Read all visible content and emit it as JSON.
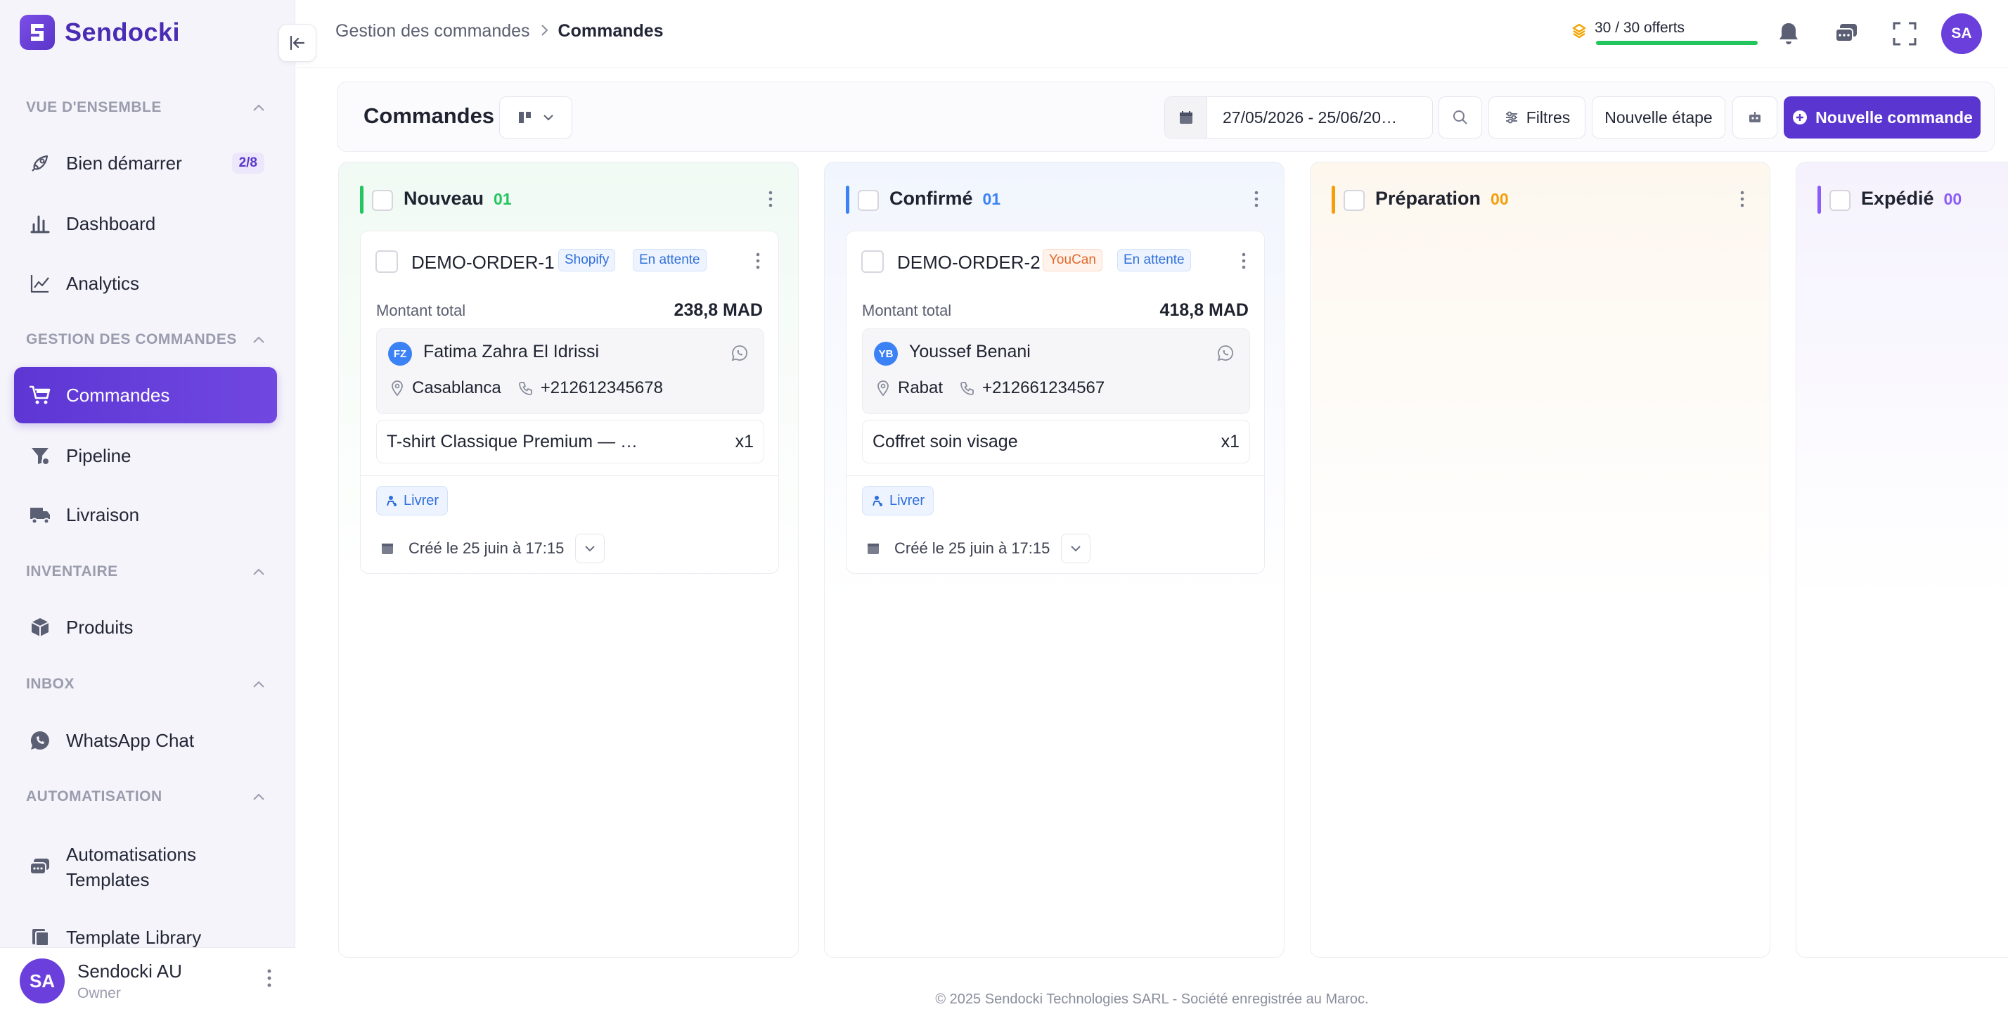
{
  "app": {
    "name": "Sendocki"
  },
  "sidebar": {
    "sections": [
      {
        "label": "VUE D'ENSEMBLE"
      },
      {
        "label": "GESTION DES COMMANDES"
      },
      {
        "label": "INVENTAIRE"
      },
      {
        "label": "INBOX"
      },
      {
        "label": "AUTOMATISATION"
      }
    ],
    "items": [
      {
        "label": "Bien démarrer",
        "count": "2/8",
        "icon": "rocket-icon"
      },
      {
        "label": "Dashboard",
        "icon": "bar-chart-icon"
      },
      {
        "label": "Analytics",
        "icon": "line-chart-icon"
      },
      {
        "label": "Commandes",
        "icon": "cart-icon",
        "active": true
      },
      {
        "label": "Pipeline",
        "icon": "funnel-icon"
      },
      {
        "label": "Livraison",
        "icon": "truck-icon"
      },
      {
        "label": "Produits",
        "icon": "box-icon"
      },
      {
        "label": "WhatsApp Chat",
        "icon": "whatsapp-icon"
      },
      {
        "label_line1": "Automatisations",
        "label_line2": "Templates",
        "icon": "chat-bubbles-icon"
      },
      {
        "label": "Template Library",
        "icon": "library-icon"
      }
    ],
    "user": {
      "initials": "SA",
      "name": "Sendocki AU",
      "role": "Owner"
    }
  },
  "header": {
    "breadcrumb": [
      "Gestion des commandes",
      "Commandes"
    ],
    "credits": {
      "text": "30 / 30 offerts",
      "progress": 1.0
    },
    "avatar": "SA"
  },
  "toolbar": {
    "title": "Commandes",
    "date_range": "27/05/2026 - 25/06/20…",
    "filters_label": "Filtres",
    "new_stage_label": "Nouvelle étape",
    "new_order_label": "Nouvelle commande"
  },
  "columns": [
    {
      "title": "Nouveau",
      "count": "01",
      "color": "#22c55e",
      "tint": "#f1faf4"
    },
    {
      "title": "Confirmé",
      "count": "01",
      "color": "#3b82f6",
      "tint": "#f1f5fd"
    },
    {
      "title": "Préparation",
      "count": "00",
      "color": "#f59e0b",
      "tint": "#fdf7ee"
    },
    {
      "title": "Expédié",
      "count": "00",
      "color": "#8b5cf6",
      "tint": "#f5f2fd"
    }
  ],
  "cards": [
    {
      "order_id": "DEMO-ORDER-1",
      "source": "Shopify",
      "status": "En attente",
      "total_label": "Montant total",
      "total": "238,8 MAD",
      "customer_initials": "FZ",
      "customer_name": "Fatima Zahra El Idrissi",
      "city": "Casablanca",
      "phone": "+212612345678",
      "product": "T-shirt Classique Premium — …",
      "qty": "x1",
      "deliver_label": "Livrer",
      "created": "Créé le 25 juin à 17:15"
    },
    {
      "order_id": "DEMO-ORDER-2",
      "source": "YouCan",
      "status": "En attente",
      "total_label": "Montant total",
      "total": "418,8 MAD",
      "customer_initials": "YB",
      "customer_name": "Youssef Benani",
      "city": "Rabat",
      "phone": "+212661234567",
      "product": "Coffret soin visage",
      "qty": "x1",
      "deliver_label": "Livrer",
      "created": "Créé le 25 juin à 17:15"
    }
  ],
  "footer": {
    "text": "© 2025 Sendocki Technologies SARL - Société enregistrée au Maroc."
  }
}
